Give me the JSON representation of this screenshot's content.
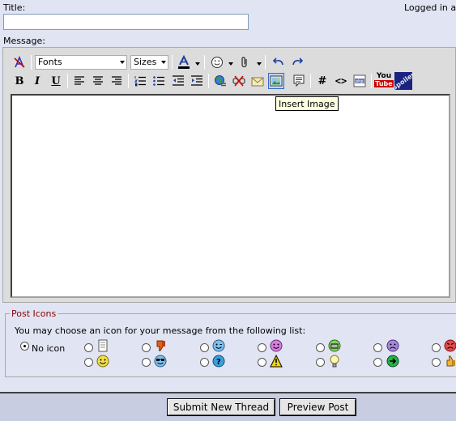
{
  "form": {
    "title_label": "Title:",
    "title_value": "",
    "logged_in_text": "Logged in a",
    "message_label": "Message:"
  },
  "toolbar": {
    "font_combo": "Fonts",
    "size_combo": "Sizes",
    "bold": "B",
    "italic": "I",
    "underline": "U",
    "hash": "#",
    "code": "<>",
    "youtube_top": "You",
    "youtube_bottom": "Tube",
    "spoiler": "Spoiler"
  },
  "tooltip": "Insert Image",
  "post_icons": {
    "legend": "Post Icons",
    "instruction": "You may choose an icon for your message from the following list:",
    "no_icon_label": "No icon",
    "selected": "no-icon",
    "icons_row1": [
      "post-icon",
      "thumbs-down",
      "wink",
      "smile",
      "grin",
      "frown",
      "angry"
    ],
    "icons_row2": [
      "happy",
      "cool",
      "question",
      "exclamation",
      "lightbulb",
      "arrow",
      "thumbs-up"
    ]
  },
  "buttons": {
    "submit": "Submit New Thread",
    "preview": "Preview Post"
  },
  "colors": {
    "page_bg": "#e1e4f2",
    "editor_bg": "#dcdcdc",
    "legend_color": "#8b0000",
    "font_color_bar": "#000000"
  }
}
